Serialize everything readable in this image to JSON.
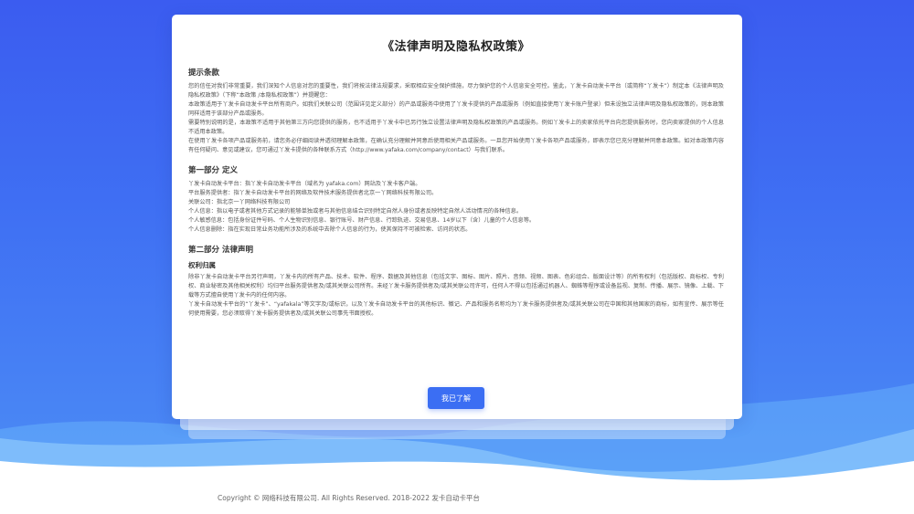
{
  "page": {
    "title": "《法律声明及隐私权政策》"
  },
  "intro": {
    "heading": "提示条款",
    "paragraphs": [
      "您的信任对我们非常重要，我们深知个人信息对您的重要性，我们将按法律法规要求，采取相应安全保护措施，尽力保护您的个人信息安全可控。鉴此，丫发卡自动发卡平台（或简称“丫发卡”）制定本《法律声明及隐私权政策》（下称“本政策 /本隐私权政策”）并提醒您：",
      "本政策适用于丫发卡自动发卡平台所有商户。如我们关联公司（范围详见定义部分）的产品或服务中使用了丫发卡提供的产品或服务（例如直接使用丫发卡账户登录）但未设独立法律声明及隐私权政策的，则本政策同样适用于该部分产品或服务。",
      "需要特别说明的是，本政策不适用于其他第三方向您提供的服务，也不适用于丫发卡中已另行独立设置法律声明及隐私权政策的产品或服务。例如丫发卡上的卖家依托平台向您提供服务时，您向卖家提供的个人信息不适用本政策。",
      "在使用丫发卡各项产品或服务前，请您务必仔细阅读并透彻理解本政策，在确认充分理解并同意后使用相关产品或服务。一旦您开始使用丫发卡各项产品或服务，即表示您已充分理解并同意本政策。如对本政策内容有任何疑问、意见或建议，您可通过丫发卡提供的各种联系方式（http://www.yafaka.com/company/contact）与我们联系。"
    ]
  },
  "part1": {
    "heading": "第一部分 定义",
    "items": [
      "丫发卡自动发卡平台：指丫发卡自动发卡平台（域名为 yafaka.com）网站及丫发卡客户端。",
      "平台服务提供者：指丫发卡自动发卡平台的网络及软件技术服务提供者北京一丫网络科技有限公司。",
      "关联公司：指北京一丫网络科技有限公司",
      "个人信息：指以电子或者其他方式记录的能够单独或者与其他信息结合识别特定自然人身份或者反映特定自然人活动情况的各种信息。",
      "个人敏感信息：包括身份证件号码、个人生物识别信息、银行账号、财产信息、行踪轨迹、交易信息、14岁以下（含）儿童的个人信息等。",
      "个人信息删除：指在实现日常业务功能所涉及的系统中去除个人信息的行为，使其保持不可被检索、访问的状态。"
    ]
  },
  "part2": {
    "heading": "第二部分 法律声明",
    "subheading": "权利归属",
    "paragraphs": [
      "除非丫发卡自动发卡平台另行声明，丫发卡内的所有产品、技术、软件、程序、数据及其他信息（包括文字、图标、图片、照片、音频、视频、图表、色彩组合、版面设计等）的所有权利（包括版权、商标权、专利权、商业秘密及其他相关权利）均归平台服务提供者及/或其关联公司所有。未经丫发卡服务提供者及/或其关联公司许可，任何人不得以包括通过机器人、蜘蛛等程序或设备监视、复制、传播、展示、镜像、上载、下载等方式擅自使用丫发卡内的任何内容。",
      "丫发卡自动发卡平台的“丫发卡”、“yafakala”等文字及/或标识，以及丫发卡自动发卡平台的其他标识、徽记、产品和服务名称均为丫发卡服务提供者及/或其关联公司在中国和其他国家的商标，如有宣传、展示等任何使用需要，您必须取得丫发卡服务提供者及/或其关联公司事先书面授权。"
    ]
  },
  "button": {
    "label": "我已了解"
  },
  "footer": {
    "text": "Copyright © 网络科技有限公司. All Rights Reserved. 2018-2022 发卡自动卡平台"
  },
  "colors": {
    "accent": "#3b6ef3",
    "bg_top": "#3b5cf0",
    "bg_bottom": "#4d8ff5"
  }
}
